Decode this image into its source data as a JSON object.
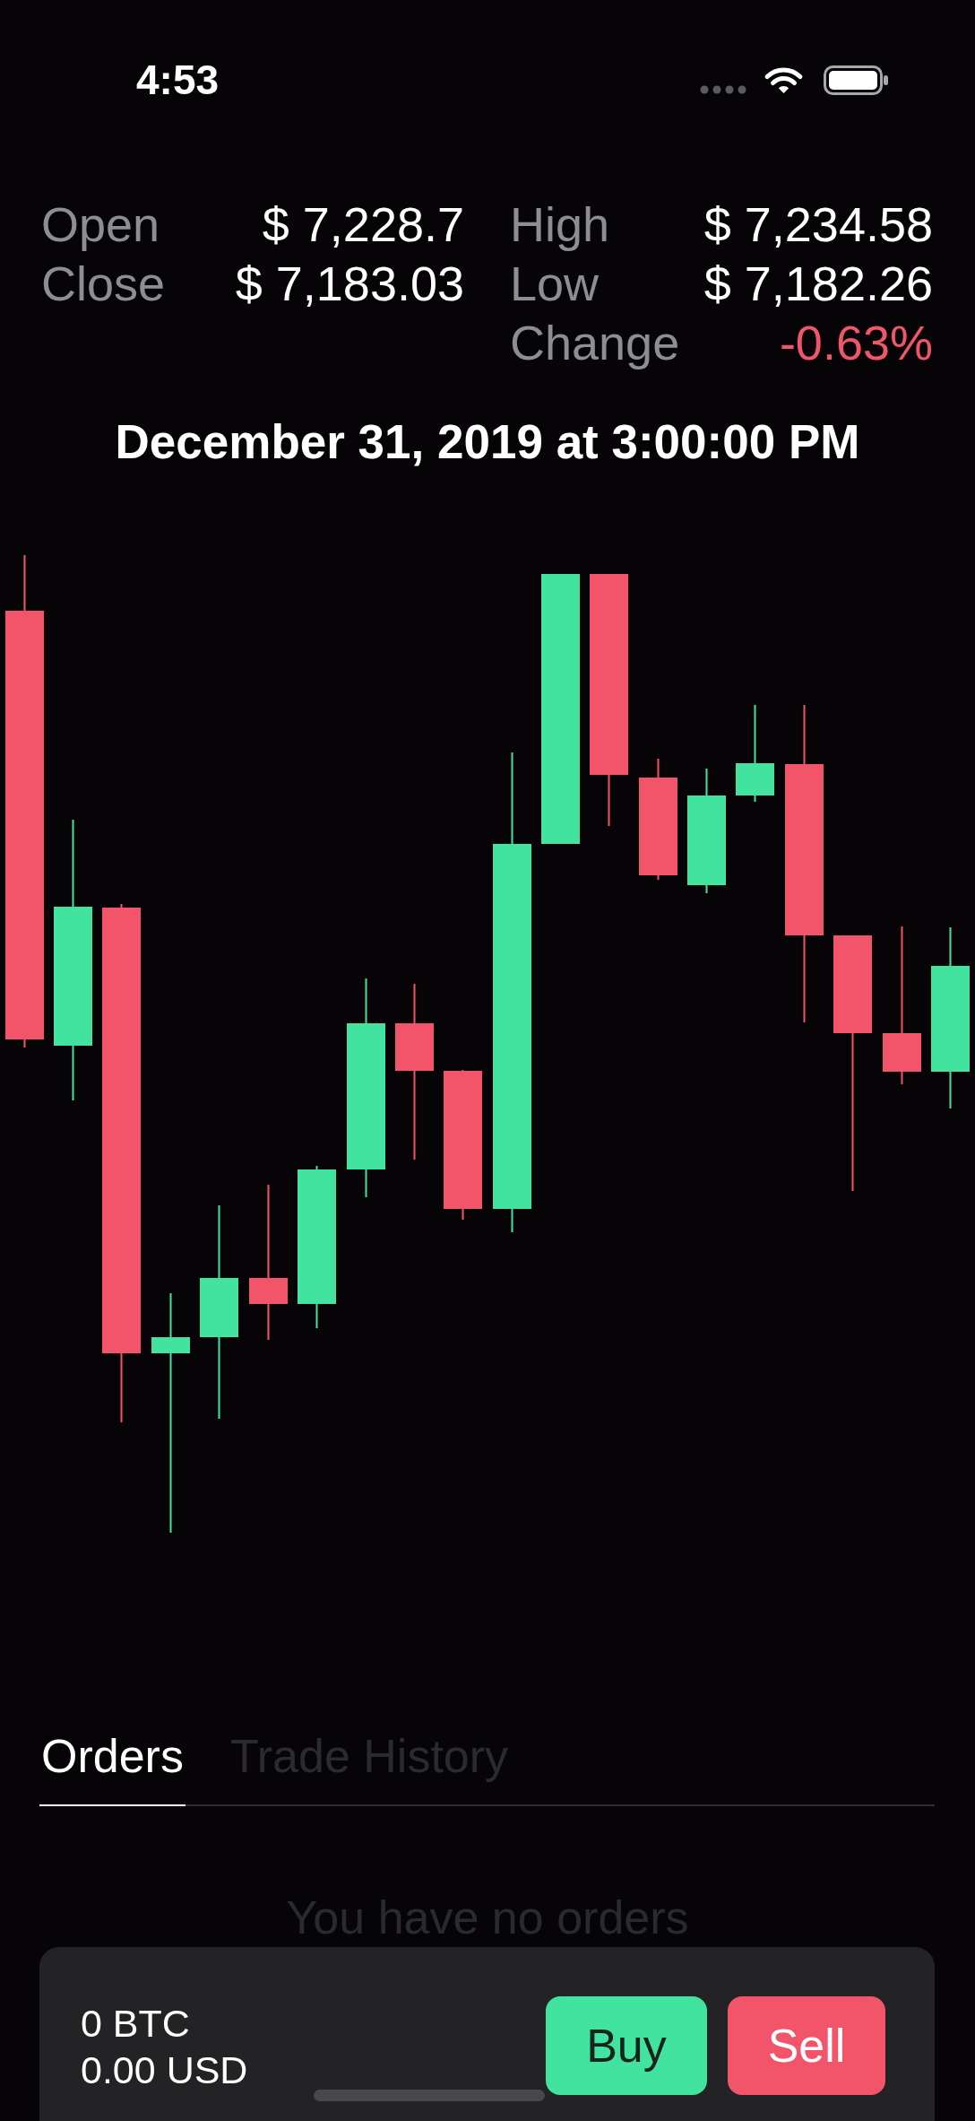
{
  "status_bar": {
    "time": "4:53"
  },
  "stats": [
    [
      {
        "label": "Open",
        "value": "$ 7,228.7",
        "negative": false
      },
      {
        "label": "Close",
        "value": "$ 7,183.03",
        "negative": false
      }
    ],
    [
      {
        "label": "High",
        "value": "$ 7,234.58",
        "negative": false
      },
      {
        "label": "Low",
        "value": "$ 7,182.26",
        "negative": false
      },
      {
        "label": "Change",
        "value": "-0.63%",
        "negative": true
      }
    ]
  ],
  "timestamp": "December 31, 2019 at 3:00:00 PM",
  "tabs": [
    {
      "label": "Orders",
      "selected": true
    },
    {
      "label": "Trade History",
      "selected": false
    }
  ],
  "empty_message": "You have no orders",
  "balance": {
    "lines": [
      "0 BTC",
      "0.00 USD"
    ]
  },
  "buttons": [
    {
      "label": "Buy",
      "kind": "buy"
    },
    {
      "label": "Sell",
      "kind": "sell"
    }
  ]
}
